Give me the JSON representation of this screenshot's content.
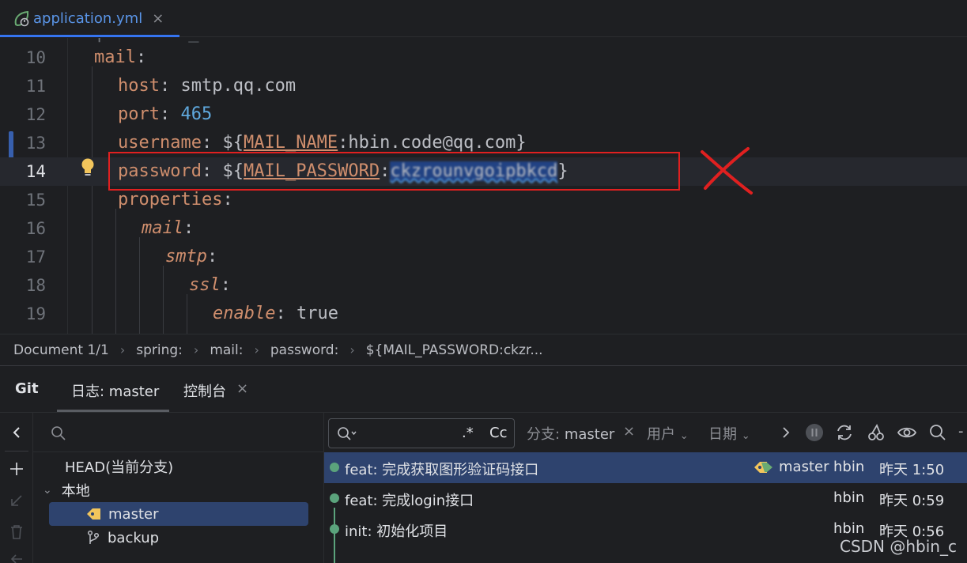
{
  "tab": {
    "filename": "application.yml",
    "close": "×",
    "icon": "spring-icon"
  },
  "editor": {
    "lines": [
      {
        "num": "10"
      },
      {
        "num": "11"
      },
      {
        "num": "12"
      },
      {
        "num": "13"
      },
      {
        "num": "14"
      },
      {
        "num": "15"
      },
      {
        "num": "16"
      },
      {
        "num": "17"
      },
      {
        "num": "18"
      },
      {
        "num": "19"
      }
    ],
    "code": {
      "mail": "mail",
      "colon": ":",
      "host_key": "host",
      "host_val": " smtp.qq.com",
      "port_key": "port",
      "port_val": "465",
      "username_key": "username",
      "username_open": " ${",
      "username_env": "MAIL_NAME",
      "username_default": ":hbin.code@qq.com}",
      "password_key": "password",
      "password_open": " ${",
      "password_env": "MAIL_PASSWORD",
      "password_colon": ":",
      "password_secret": "ckzrounvgoipbkcd",
      "password_close": "}",
      "properties_key": "properties",
      "mail2_key": "mail",
      "smtp_key": "smtp",
      "ssl_key": "ssl",
      "enable_key": "enable",
      "enable_val": " true"
    },
    "annotation": "red-cross-mark"
  },
  "breadcrumb": [
    "Document 1/1",
    "spring:",
    "mail:",
    "password:",
    "${MAIL_PASSWORD:ckzr..."
  ],
  "git": {
    "title": "Git",
    "tabs": [
      {
        "label": "日志: master"
      },
      {
        "label": "控制台"
      }
    ],
    "close": "×",
    "tree": {
      "head": "HEAD(当前分支)",
      "local": "本地",
      "branches": [
        "master",
        "backup"
      ]
    },
    "toolbar": {
      "regex": ".*",
      "case": "Cc",
      "branch_label": "分支:",
      "branch_value": "master",
      "branch_clear": "×",
      "user": "用户",
      "date": "日期"
    },
    "commits": [
      {
        "message": "feat: 完成获取图形验证码接口",
        "branch": "master",
        "author": "hbin",
        "date": "昨天 1:50"
      },
      {
        "message": "feat: 完成login接口",
        "author": "hbin",
        "date": "昨天 0:59"
      },
      {
        "message": "init: 初始化项目",
        "author": "hbin",
        "date": "昨天 0:56"
      }
    ]
  },
  "watermark": "CSDN @hbin_c",
  "colors": {
    "accent": "#3574f0",
    "keyword": "#cf8e6d",
    "number": "#5fa8dd",
    "selection": "#2e436e",
    "graph": "#5ba37c",
    "annotation": "#e02020"
  }
}
